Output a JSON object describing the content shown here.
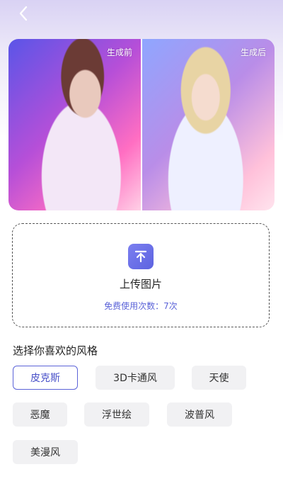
{
  "header": {
    "back_icon": "chevron-left-icon"
  },
  "compare": {
    "before_label": "生成前",
    "after_label": "生成后"
  },
  "upload": {
    "icon": "upload-icon",
    "label": "上传图片",
    "free_count": "免费使用次数：7次"
  },
  "styles": {
    "title": "选择你喜欢的风格",
    "selected": "皮克斯",
    "items": [
      "皮克斯",
      "3D卡通风",
      "天使",
      "恶魔",
      "浮世绘",
      "波普风",
      "美漫风"
    ]
  },
  "colors": {
    "accent": "#5b63d8",
    "chip_bg": "#f1f1f3"
  }
}
